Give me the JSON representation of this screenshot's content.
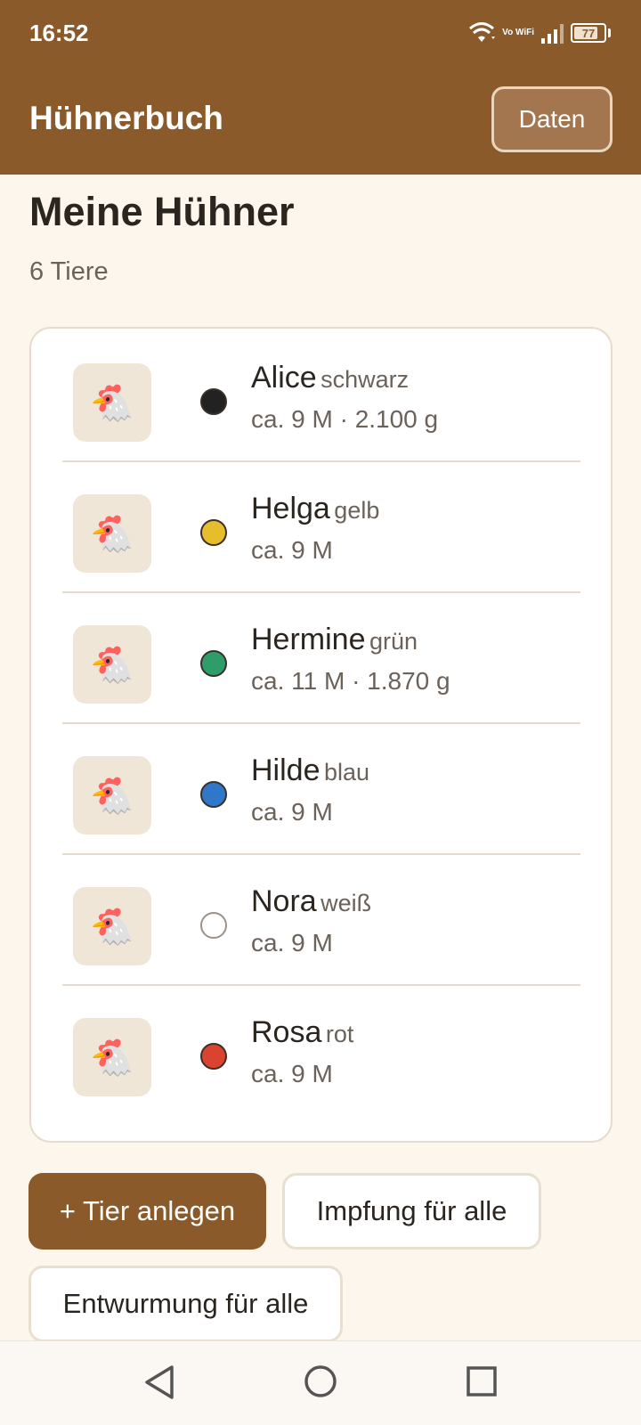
{
  "status_bar": {
    "time": "16:52",
    "vowifi": "Vo WiFi",
    "battery": "77"
  },
  "header": {
    "title": "Hühnerbuch",
    "daten_button": "Daten",
    "background": "#8b5a2b"
  },
  "main": {
    "title": "Meine Hühner",
    "count": "6 Tiere",
    "animals": [
      {
        "name": "Alice",
        "color_label": "schwarz",
        "meta": "ca. 9 M · 2.100 g",
        "dot_color": "#222222",
        "icon": "chicken-icon"
      },
      {
        "name": "Helga",
        "color_label": "gelb",
        "meta": "ca. 9 M",
        "dot_color": "#e6be2c",
        "icon": "chicken-icon"
      },
      {
        "name": "Hermine",
        "color_label": "grün",
        "meta": "ca. 11 M · 1.870 g",
        "dot_color": "#2f9d6a",
        "icon": "chicken-icon"
      },
      {
        "name": "Hilde",
        "color_label": "blau",
        "meta": "ca. 9 M",
        "dot_color": "#2f78c9",
        "icon": "chicken-icon"
      },
      {
        "name": "Nora",
        "color_label": "weiß",
        "meta": "ca. 9 M",
        "dot_color": "#ffffff",
        "icon": "chicken-icon"
      },
      {
        "name": "Rosa",
        "color_label": "rot",
        "meta": "ca. 9 M",
        "dot_color": "#d9432f",
        "icon": "chicken-icon"
      }
    ]
  },
  "actions": {
    "add_animal": "+ Tier anlegen",
    "vaccinate_all": "Impfung für alle",
    "deworm_all": "Entwurmung für alle"
  },
  "nav": {
    "back": "back-icon",
    "home": "home-icon",
    "recents": "recents-icon"
  }
}
